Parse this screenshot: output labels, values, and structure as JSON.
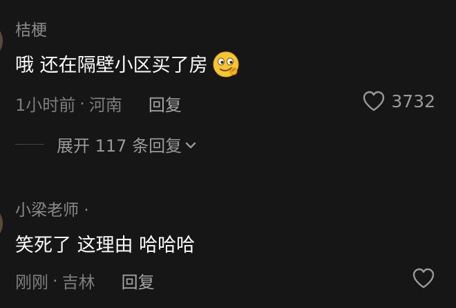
{
  "comments": [
    {
      "username": "桔梗",
      "text": "哦 还在隔壁小区买了房",
      "emoji": "smirk-emoji",
      "time": "1小时前",
      "separator": "·",
      "location": "河南",
      "reply_label": "回复",
      "like_count": "3732",
      "expand_label": "展开 117 条回复"
    },
    {
      "username": "小梁老师",
      "username_suffix": "·",
      "text": "笑死了 这理由 哈哈哈",
      "time": "刚刚",
      "separator": "·",
      "location": "吉林",
      "reply_label": "回复"
    }
  ],
  "colors": {
    "background": "#161616",
    "text_primary": "#ffffff",
    "text_secondary": "#8a8a8a"
  },
  "icons": [
    "heart-outline-icon",
    "chevron-down-icon",
    "smirk-emoji"
  ]
}
